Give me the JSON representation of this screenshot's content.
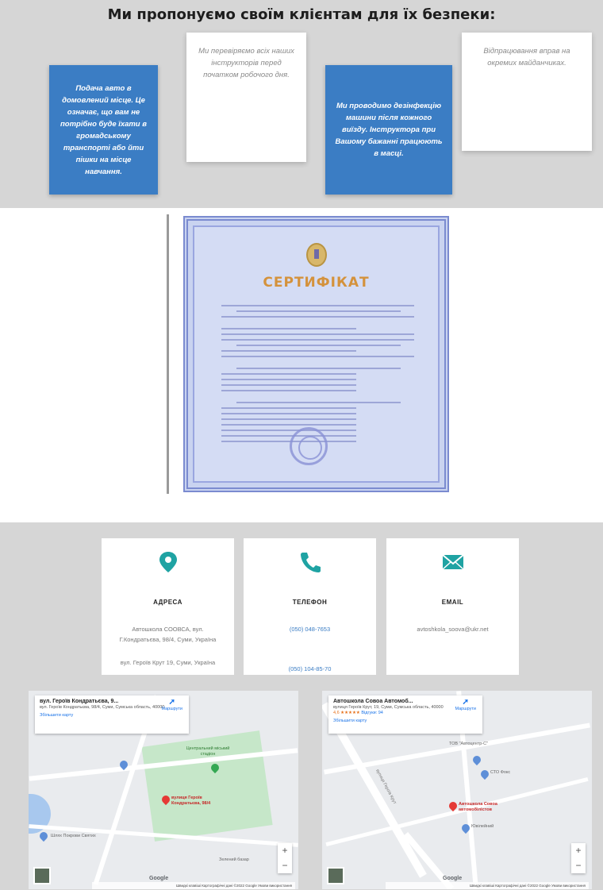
{
  "features": {
    "title": "Ми пропонуємо своїм клієнтам для їх безпеки:",
    "cards": [
      {
        "text": "Подача авто в домовлений місце. Це означає, що вам не потрібно буде їхати в громадському транспорті або йти пішки на місце навчання."
      },
      {
        "text": "Ми перевіряємо всіх наших інструкторів перед початком робочого дня."
      },
      {
        "text": "Ми проводимо дезінфекцію машини після кожного виїзду. Інструктора при Вашому бажанні працюють в масці."
      },
      {
        "text": "Відпрацювання вправ на окремих майданчиках."
      }
    ]
  },
  "certificate": {
    "title": "СЕРТИФІКАТ"
  },
  "contacts": {
    "address": {
      "icon": "map-pin-icon",
      "label": "АДРЕСА",
      "line1": "Автошкола СООВСА, вул. Г.Кондратьєва, 98/4, Суми, Україна",
      "line2": "вул. Героїв Крут 19, Суми, Україна"
    },
    "phone": {
      "icon": "phone-icon",
      "label": "ТЕЛЕФОН",
      "phone1": "(050) 048-7653",
      "phone2": "(050) 104-85-70"
    },
    "email": {
      "icon": "envelope-icon",
      "label": "EMAIL",
      "value": "avtoshkola_soova@ukr.net"
    }
  },
  "maps": [
    {
      "title": "вул. Героїв Кондратьєва, 9...",
      "address": "вул. Героїв Кондратьєва, 98/4, Суми, Сумська область, 40000",
      "larger_map": "Збільшити карту",
      "directions": "Маршрути",
      "pin_label": "вулиця Героїв Кондратьєва, 98/4",
      "place1": "Центральний міський стадіон",
      "place2": "Шлях Покрови Святих",
      "place3": "Зелений базар",
      "google": "Google",
      "attribution": "Швидкі клавіші  Картографічні дані ©2022 Google  Умови використання"
    },
    {
      "title": "Автошкола Совоа Автомоб...",
      "address": "вулиця Героїв Крут, 19, Суми, Сумська область, 40000",
      "rating": "4,6 ★★★★★",
      "reviews": "Відгуки: 94",
      "larger_map": "Збільшити карту",
      "directions": "Маршрути",
      "pin_label": "Автошкола Совоа автомобілістов",
      "street": "вулиця Героїв Крут",
      "place1": "ТОВ \"Автоцентр-С\"",
      "place2": "СТО Фокс",
      "place3": "Ювілейний",
      "google": "Google",
      "attribution": "Швидкі клавіші  Картографічні дані ©2022 Google  Умови використання"
    }
  ],
  "colors": {
    "section_bg": "#d6d6d6",
    "accent_blue": "#3b7dc4",
    "icon_teal": "#1fa3a3",
    "cert_gold": "#d4923c"
  }
}
